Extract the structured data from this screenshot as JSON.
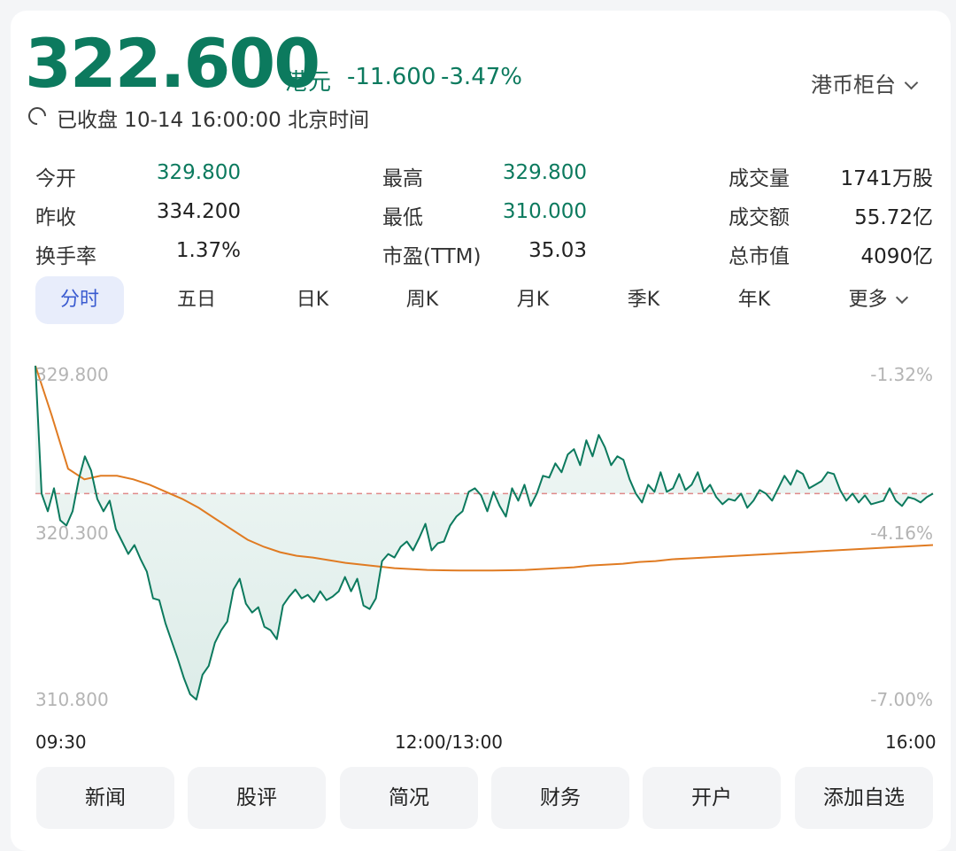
{
  "header": {
    "price": "322.600",
    "currency": "港元",
    "change": "-11.600",
    "change_pct": "-3.47%",
    "counter_select": "港币柜台",
    "status": "已收盘 10-14 16:00:00 北京时间"
  },
  "quote": {
    "open_label": "今开",
    "open": "329.800",
    "prev_close_label": "昨收",
    "prev_close": "334.200",
    "turnover_rate_label": "换手率",
    "turnover_rate": "1.37%",
    "high_label": "最高",
    "high": "329.800",
    "low_label": "最低",
    "low": "310.000",
    "pe_label": "市盈(TTM)",
    "pe": "35.03",
    "volume_label": "成交量",
    "volume": "1741万股",
    "amount_label": "成交额",
    "amount": "55.72亿",
    "mktcap_label": "总市值",
    "mktcap": "4090亿"
  },
  "tabs": [
    "分时",
    "五日",
    "日K",
    "周K",
    "月K",
    "季K",
    "年K",
    "更多"
  ],
  "bottom_buttons": [
    "新闻",
    "股评",
    "简况",
    "财务",
    "开户",
    "添加自选"
  ],
  "colors": {
    "price": "#0c7a5e",
    "avg": "#e07b22",
    "ref": "#e08a8a",
    "tab_active": "#3a5bd0"
  },
  "chart_data": {
    "type": "line",
    "x_tick_labels": [
      "09:30",
      "12:00/13:00",
      "16:00"
    ],
    "y_tick_labels_left": [
      "329.800",
      "320.300",
      "310.800"
    ],
    "y_tick_labels_right": [
      "-1.32%",
      "-4.16%",
      "-7.00%"
    ],
    "ylim": [
      310.8,
      329.8
    ],
    "reference_line": 322.6,
    "series": [
      {
        "key": "price",
        "values": [
          329.8,
          322.6,
          321.6,
          322.9,
          321.1,
          320.8,
          321.6,
          323.4,
          324.7,
          323.9,
          322.3,
          321.6,
          322.2,
          320.6,
          319.9,
          319.2,
          319.7,
          318.9,
          318.2,
          316.7,
          316.6,
          315.3,
          314.3,
          313.3,
          312.2,
          311.3,
          311.0,
          312.4,
          312.9,
          314.2,
          314.9,
          315.4,
          317.2,
          317.8,
          316.4,
          315.9,
          316.2,
          315.1,
          314.9,
          314.4,
          316.3,
          316.8,
          317.2,
          316.7,
          316.9,
          316.5,
          317.1,
          316.6,
          316.8,
          317.1,
          317.9,
          317.1,
          317.8,
          316.3,
          316.1,
          316.7,
          318.8,
          319.2,
          319.0,
          319.6,
          319.9,
          319.4,
          320.1,
          320.9,
          319.4,
          319.8,
          319.9,
          320.8,
          321.3,
          321.6,
          322.7,
          322.9,
          322.5,
          321.6,
          322.7,
          321.9,
          321.3,
          322.9,
          322.2,
          323.1,
          321.9,
          322.6,
          323.6,
          323.5,
          324.3,
          323.8,
          324.8,
          325.1,
          324.2,
          325.6,
          324.7,
          325.9,
          325.2,
          324.2,
          324.7,
          324.5,
          323.4,
          322.6,
          322.1,
          323.1,
          322.7,
          323.8,
          322.7,
          322.9,
          323.7,
          322.8,
          323.1,
          323.8,
          322.7,
          323.1,
          322.4,
          322.0,
          322.3,
          322.2,
          322.6,
          321.8,
          322.2,
          322.8,
          322.6,
          322.2,
          322.9,
          323.6,
          323.1,
          323.9,
          323.7,
          322.9,
          323.1,
          323.3,
          323.8,
          323.7,
          322.8,
          322.2,
          322.6,
          322.1,
          322.5,
          322.0,
          322.1,
          322.2,
          322.9,
          322.2,
          321.9,
          322.4,
          322.3,
          322.1,
          322.4,
          322.6
        ],
        "note": ""
      },
      {
        "key": "avg",
        "values": [
          329.8,
          327.0,
          324.0,
          323.4,
          323.6,
          323.6,
          323.4,
          323.1,
          322.7,
          322.3,
          321.8,
          321.2,
          320.6,
          320.0,
          319.6,
          319.3,
          319.1,
          319.0,
          318.85,
          318.7,
          318.6,
          318.5,
          318.4,
          318.35,
          318.3,
          318.28,
          318.27,
          318.27,
          318.27,
          318.28,
          318.3,
          318.35,
          318.4,
          318.45,
          318.55,
          318.6,
          318.65,
          318.75,
          318.8,
          318.9,
          318.95,
          319.0,
          319.05,
          319.1,
          319.15,
          319.2,
          319.25,
          319.3,
          319.35,
          319.4,
          319.45,
          319.5,
          319.55,
          319.6,
          319.65,
          319.7
        ],
        "note": ""
      }
    ]
  }
}
